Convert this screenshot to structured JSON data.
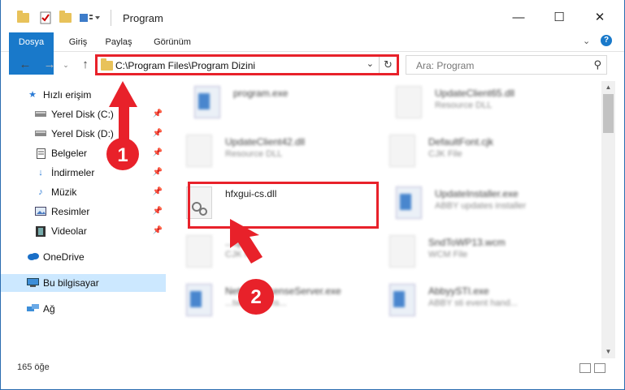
{
  "window": {
    "title": "Program",
    "minimize_icon": "minimize-icon",
    "maximize_icon": "maximize-icon",
    "close_icon": "close-icon"
  },
  "ribbon": {
    "tabs": [
      "Dosya",
      "Giriş",
      "Paylaş",
      "Görünüm"
    ]
  },
  "address": {
    "path": "C:\\Program Files\\Program Dizini",
    "search_placeholder": "Ara: Program"
  },
  "sidebar": {
    "items": [
      {
        "label": "Hızlı erişim",
        "icon": "star-icon",
        "pinned": false
      },
      {
        "label": "Yerel Disk (C:)",
        "icon": "drive-icon",
        "pinned": true
      },
      {
        "label": "Yerel Disk (D:)",
        "icon": "drive-icon",
        "pinned": true
      },
      {
        "label": "Belgeler",
        "icon": "document-icon",
        "pinned": true
      },
      {
        "label": "İndirmeler",
        "icon": "download-icon",
        "pinned": true
      },
      {
        "label": "Müzik",
        "icon": "music-icon",
        "pinned": true
      },
      {
        "label": "Resimler",
        "icon": "picture-icon",
        "pinned": true
      },
      {
        "label": "Videolar",
        "icon": "video-icon",
        "pinned": true
      },
      {
        "label": "OneDrive",
        "icon": "cloud-icon",
        "pinned": false
      },
      {
        "label": "Bu bilgisayar",
        "icon": "computer-icon",
        "pinned": false
      },
      {
        "label": "Ağ",
        "icon": "network-icon",
        "pinned": false
      }
    ]
  },
  "files": [
    {
      "name": "program.exe",
      "type": ""
    },
    {
      "name": "UpdateClient65.dll",
      "type": "Resource DLL"
    },
    {
      "name": "UpdateClient42.dll",
      "type": "Resource DLL"
    },
    {
      "name": "DefaultFont.cjk",
      "type": "CJK File"
    },
    {
      "name": "hfxgui-cs.dll",
      "type": ""
    },
    {
      "name": "UpdateInstaller.exe",
      "type": "ABBY updates installer"
    },
    {
      "name": "...cjk",
      "type": "CJK File"
    },
    {
      "name": "SndToWP13.wcm",
      "type": "WCM File"
    },
    {
      "name": "NetworkLicenseServer.exe",
      "type": "...twork licens..."
    },
    {
      "name": "AbbyySTI.exe",
      "type": "ABBY sti event hand..."
    }
  ],
  "status": {
    "count": "165 öğe"
  },
  "annotations": {
    "step1": "1",
    "step2": "2",
    "color": "#e8212a"
  }
}
